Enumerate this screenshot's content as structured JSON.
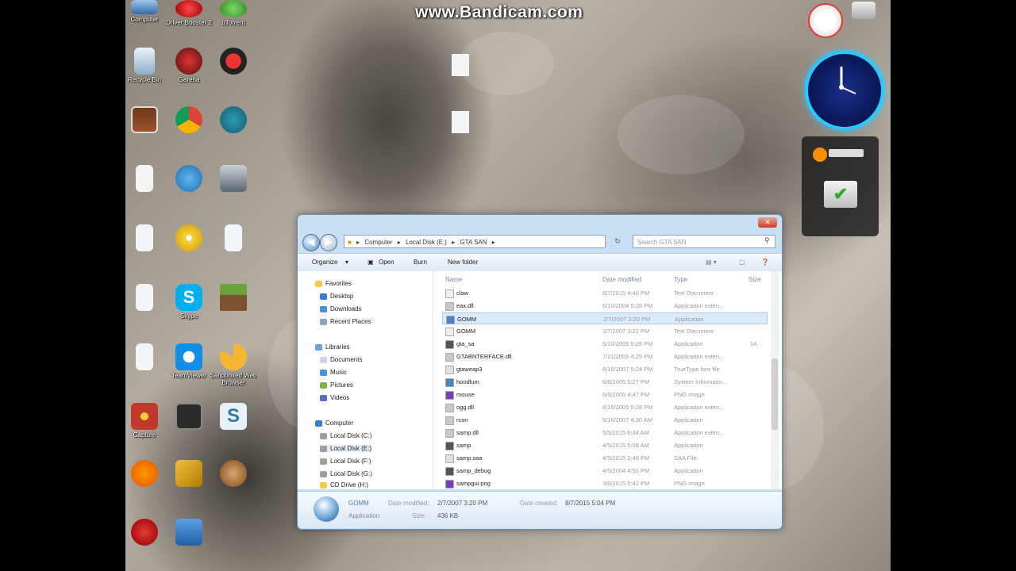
{
  "watermark": {
    "text": "www.Bandicam.com"
  },
  "desktop_icons": [
    {
      "label": "Computer",
      "icon": "computer-icon"
    },
    {
      "label": "Driver Booster 2",
      "icon": "driver-booster-icon"
    },
    {
      "label": "uTorrent",
      "icon": "utorrent-icon"
    },
    {
      "label": "Recycle Bin",
      "icon": "recycle-bin-icon"
    },
    {
      "label": "Garena",
      "icon": "garena-icon"
    },
    {
      "label": "",
      "icon": "app-icon"
    },
    {
      "label": "",
      "icon": "photo-icon"
    },
    {
      "label": "",
      "icon": "chrome-icon"
    },
    {
      "label": "",
      "icon": "gear-app-icon"
    },
    {
      "label": "",
      "icon": "document-icon"
    },
    {
      "label": "",
      "icon": "media-icon"
    },
    {
      "label": "",
      "icon": "counter-strike-icon"
    },
    {
      "label": "",
      "icon": "music-icon"
    },
    {
      "label": "",
      "icon": "cd-icon"
    },
    {
      "label": "",
      "icon": "shortcut-icon"
    },
    {
      "label": "",
      "icon": "music-icon"
    },
    {
      "label": "Skype",
      "icon": "skype-icon"
    },
    {
      "label": "",
      "icon": "minecraft-icon"
    },
    {
      "label": "",
      "icon": "music-icon"
    },
    {
      "label": "TeamViewer",
      "icon": "teamviewer-icon"
    },
    {
      "label": "Sandboxed Web Browser",
      "icon": "pizza-icon"
    },
    {
      "label": "Capture",
      "icon": "capture-icon"
    },
    {
      "label": "",
      "icon": "film-icon"
    },
    {
      "label": "",
      "icon": "s-app-icon"
    },
    {
      "label": "",
      "icon": "avast-icon"
    },
    {
      "label": "",
      "icon": "tools-icon"
    },
    {
      "label": "",
      "icon": "user-icon"
    },
    {
      "label": "",
      "icon": "ccleaner-icon"
    },
    {
      "label": "",
      "icon": "network-icon"
    }
  ],
  "explorer": {
    "address": [
      "Computer",
      "Local Disk (E:)",
      "GTA SAN"
    ],
    "search_placeholder": "Search GTA SAN",
    "toolbar": {
      "organize": "Organize",
      "open": "Open",
      "burn": "Burn",
      "new_folder": "New folder"
    },
    "nav": {
      "favorites": "Favorites",
      "fav_items": [
        "Desktop",
        "Downloads",
        "Recent Places"
      ],
      "libraries": "Libraries",
      "lib_items": [
        "Documents",
        "Music",
        "Pictures",
        "Videos"
      ],
      "computer": "Computer",
      "drives": [
        "Local Disk (C:)",
        "Local Disk (E:)",
        "Local Disk (F:)",
        "Local Disk (G:)",
        "CD Drive (H:)"
      ]
    },
    "columns": {
      "name": "Name",
      "date": "Date modified",
      "type": "Type",
      "size": "Size"
    },
    "rows": [
      {
        "name": "claw",
        "date": "8/7/2015 4:46 PM",
        "type": "Text Document",
        "size": "",
        "color": "#f0f0f0"
      },
      {
        "name": "eax.dll",
        "date": "6/10/2004 5:26 PM",
        "type": "Application exten...",
        "size": "",
        "color": "#c9c9c9"
      },
      {
        "name": "GOMM",
        "date": "2/7/2007 3:20 PM",
        "type": "Application",
        "size": "",
        "color": "#4d83c4"
      },
      {
        "name": "GOMM",
        "date": "2/7/2007 3:22 PM",
        "type": "Text Document",
        "size": "",
        "color": "#f0f0f0"
      },
      {
        "name": "gta_sa",
        "date": "6/10/2005 5:28 PM",
        "type": "Application",
        "size": "14,",
        "color": "#555555"
      },
      {
        "name": "GTABNTERFACE.dll",
        "date": "7/21/2005 4:25 PM",
        "type": "Application exten...",
        "size": "",
        "color": "#c9c9c9"
      },
      {
        "name": "gtaweap3",
        "date": "8/16/2007 5:24 PM",
        "type": "TrueType font file",
        "size": "",
        "color": "#e0e0e0"
      },
      {
        "name": "hoodlum",
        "date": "6/6/2005 5:27 PM",
        "type": "System Informatio...",
        "size": "",
        "color": "#4d83c4"
      },
      {
        "name": "mouse",
        "date": "6/6/2005 4:47 PM",
        "type": "PNG image",
        "size": "",
        "color": "#7a3fb0"
      },
      {
        "name": "ogg.dll",
        "date": "8/16/2005 5:28 PM",
        "type": "Application exten...",
        "size": "",
        "color": "#c9c9c9"
      },
      {
        "name": "rcon",
        "date": "5/16/2007 4:30 AM",
        "type": "Application",
        "size": "",
        "color": "#c9c9c9"
      },
      {
        "name": "samp.dll",
        "date": "5/5/2015 6:34 AM",
        "type": "Application exten...",
        "size": "",
        "color": "#c9c9c9"
      },
      {
        "name": "samp",
        "date": "4/5/2015 5:56 AM",
        "type": "Application",
        "size": "",
        "color": "#555555"
      },
      {
        "name": "samp.saa",
        "date": "4/5/2015 2:40 PM",
        "type": "SAA File",
        "size": "",
        "color": "#e0e0e0"
      },
      {
        "name": "samp_debug",
        "date": "4/5/2004 4:55 PM",
        "type": "Application",
        "size": "",
        "color": "#555555"
      },
      {
        "name": "sampgui.png",
        "date": "3/6/2015 5:42 PM",
        "type": "PNG image",
        "size": "",
        "color": "#7a3fb0"
      }
    ],
    "details": {
      "name": "GOMM",
      "kind": "Application",
      "modified_label": "Date modified:",
      "modified": "2/7/2007 3:20 PM",
      "created_label": "Date created:",
      "created": "8/7/2015 5:04 PM",
      "size_label": "Size:",
      "size": "436 KB"
    }
  }
}
